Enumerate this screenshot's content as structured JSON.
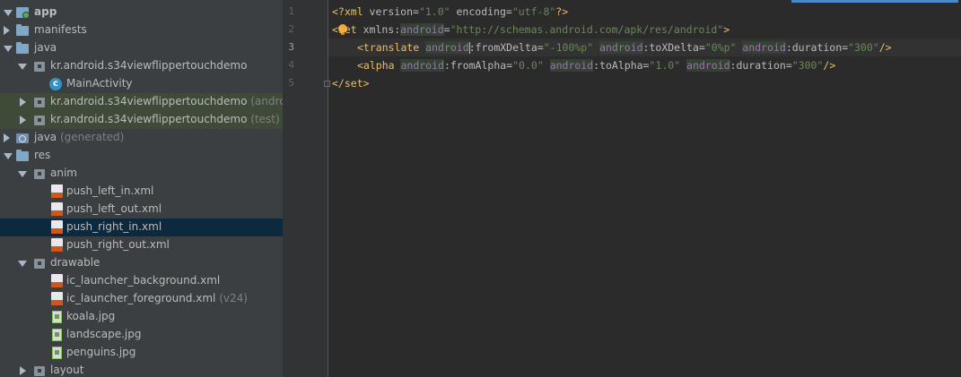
{
  "project_tree": {
    "items": [
      {
        "label": "app",
        "hint": "",
        "icon": "app-module-icon"
      },
      {
        "label": "manifests",
        "hint": "",
        "icon": "folder-icon"
      },
      {
        "label": "java",
        "hint": "",
        "icon": "folder-icon"
      },
      {
        "label": "kr.android.s34viewflippertouchdemo",
        "hint": "",
        "icon": "package-icon"
      },
      {
        "label": "MainActivity",
        "hint": "",
        "icon": "class-icon"
      },
      {
        "label": "kr.android.s34viewflippertouchdemo",
        "hint": "(androidTe",
        "icon": "package-icon"
      },
      {
        "label": "kr.android.s34viewflippertouchdemo",
        "hint": "(test)",
        "icon": "package-icon"
      },
      {
        "label": "java",
        "hint": "(generated)",
        "icon": "generated-folder-icon"
      },
      {
        "label": "res",
        "hint": "",
        "icon": "folder-icon"
      },
      {
        "label": "anim",
        "hint": "",
        "icon": "package-icon"
      },
      {
        "label": "push_left_in.xml",
        "hint": "",
        "icon": "xml-file-icon"
      },
      {
        "label": "push_left_out.xml",
        "hint": "",
        "icon": "xml-file-icon"
      },
      {
        "label": "push_right_in.xml",
        "hint": "",
        "icon": "xml-file-icon"
      },
      {
        "label": "push_right_out.xml",
        "hint": "",
        "icon": "xml-file-icon"
      },
      {
        "label": "drawable",
        "hint": "",
        "icon": "package-icon"
      },
      {
        "label": "ic_launcher_background.xml",
        "hint": "",
        "icon": "xml-file-icon"
      },
      {
        "label": "ic_launcher_foreground.xml",
        "hint": "(v24)",
        "icon": "xml-file-icon"
      },
      {
        "label": "koala.jpg",
        "hint": "",
        "icon": "image-file-icon"
      },
      {
        "label": "landscape.jpg",
        "hint": "",
        "icon": "image-file-icon"
      },
      {
        "label": "penguins.jpg",
        "hint": "",
        "icon": "image-file-icon"
      },
      {
        "label": "layout",
        "hint": "",
        "icon": "package-icon"
      }
    ]
  },
  "gutter": {
    "line_numbers": [
      "1",
      "2",
      "3",
      "4",
      "5"
    ],
    "current_line": "3"
  },
  "editor": {
    "line1": {
      "open": "<?xml ",
      "attr1": "version",
      "eq1": "=",
      "val1": "\"1.0\"",
      "attr2": " encoding",
      "eq2": "=",
      "val2": "\"utf-8\"",
      "close": "?>"
    },
    "line2": {
      "open": "<set ",
      "attr": "xmlns:",
      "ns": "android",
      "eq": "=",
      "val": "\"http://schemas.android.com/apk/res/android\"",
      "close": ">"
    },
    "line3": {
      "open": "<translate ",
      "ns1": "android",
      "attr1": ":fromXDelta",
      "eq1": "=",
      "val1": "\"-100%p\"",
      "ns2": "android",
      "attr2": ":toXDelta",
      "eq2": "=",
      "val2": "\"0%p\"",
      "ns3": "android",
      "attr3": ":duration",
      "eq3": "=",
      "val3": "\"300\"",
      "close": "/>"
    },
    "line4": {
      "open": "<alpha ",
      "ns1": "android",
      "attr1": ":fromAlpha",
      "eq1": "=",
      "val1": "\"0.0\"",
      "ns2": "android",
      "attr2": ":toAlpha",
      "eq2": "=",
      "val2": "\"1.0\"",
      "ns3": "android",
      "attr3": ":duration",
      "eq3": "=",
      "val3": "\"300\"",
      "close": "/>"
    },
    "line5": {
      "close": "</set>"
    }
  },
  "colors": {
    "tree_bg": "#3c3f41",
    "editor_bg": "#2b2b2b",
    "tag": "#e8bf6a",
    "string": "#6a8759",
    "namespace": "#9876aa",
    "selection": "#0d293e"
  }
}
